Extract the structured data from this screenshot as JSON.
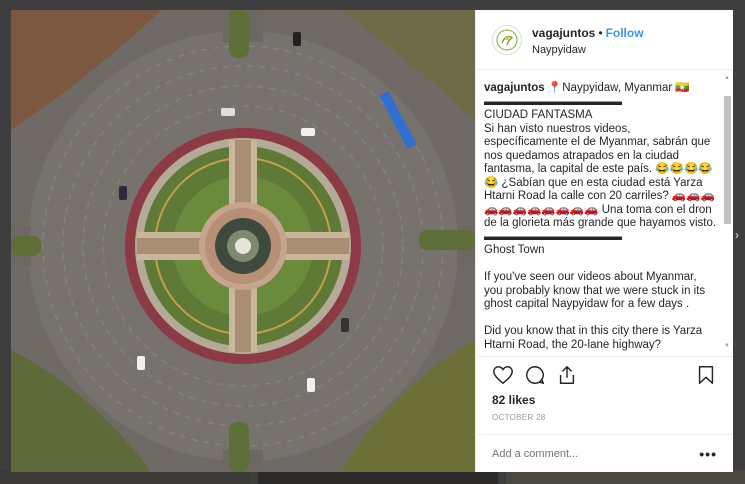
{
  "post": {
    "username": "vagajuntos",
    "dot": "•",
    "follow_label": "Follow",
    "location": "Naypyidaw",
    "caption_user": "vagajuntos",
    "caption_text": "📍Naypyidaw, Myanmar 🇲🇲\n▬▬▬▬▬▬▬▬▬▬▬▬\nCIUDAD FANTASMA\nSi han visto nuestros videos, específicamente el de Myanmar, sabrán que nos quedamos atrapados en la ciudad fantasma, la capital de este país. 😂😂😂😂😂 ¿Sabían que en esta ciudad está Yarza Htarni Road la calle con 20 carriles? 🚗🚗🚗🚗🚗🚗🚗🚗🚗🚗🚗 Una toma con el dron de la glorieta más grande que hayamos visto.\n▬▬▬▬▬▬▬▬▬▬▬▬\nGhost Town\n\nIf you've seen our videos about Myanmar, you probably know that we were stuck in its ghost capital Naypyidaw for a few days .\n\nDid you know that in this city there is Yarza Htarni Road, the 20-lane highway?",
    "likes": "82 likes",
    "date": "October 28",
    "comment_placeholder": "Add a comment...",
    "more_label": "•••"
  },
  "icons": {
    "avatar": "vagajuntos-logo-icon",
    "like": "heart-icon",
    "comment": "comment-icon",
    "share": "share-icon",
    "save": "bookmark-icon",
    "options": "more-options-icon"
  },
  "colors": {
    "follow": "#3897f0",
    "text": "#262626",
    "muted": "#999999"
  }
}
